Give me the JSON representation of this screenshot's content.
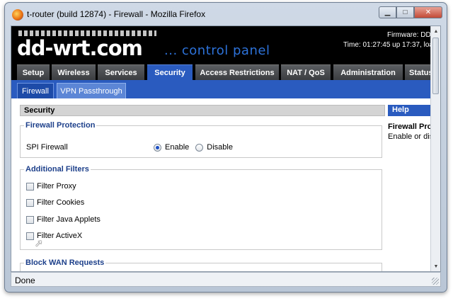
{
  "window": {
    "title": "t-router (build 12874) - Firewall - Mozilla Firefox",
    "minimize_glyph": "▁",
    "maximize_glyph": "□",
    "close_glyph": "✕"
  },
  "header": {
    "logo": "dd-wrt.com",
    "subtitle": "... control panel",
    "firmware": "Firmware: DD-",
    "time": "Time: 01:27:45 up 17:37, loa"
  },
  "main_tabs": [
    {
      "label": "Setup"
    },
    {
      "label": "Wireless"
    },
    {
      "label": "Services"
    },
    {
      "label": "Security"
    },
    {
      "label": "Access Restrictions"
    },
    {
      "label": "NAT / QoS"
    },
    {
      "label": "Administration"
    },
    {
      "label": "Status"
    }
  ],
  "sub_tabs": [
    {
      "label": "Firewall"
    },
    {
      "label": "VPN Passthrough"
    }
  ],
  "section_title": "Security",
  "help": {
    "title": "Help",
    "heading": "Firewall Pro",
    "description": "Enable or dis"
  },
  "firewall_protection": {
    "legend": "Firewall Protection",
    "label": "SPI Firewall",
    "enable_label": "Enable",
    "disable_label": "Disable",
    "selected": "Enable"
  },
  "additional_filters": {
    "legend": "Additional Filters",
    "items": [
      {
        "label": "Filter Proxy",
        "checked": false
      },
      {
        "label": "Filter Cookies",
        "checked": false
      },
      {
        "label": "Filter Java Applets",
        "checked": false
      },
      {
        "label": "Filter ActiveX",
        "checked": false
      }
    ]
  },
  "block_wan": {
    "legend": "Block WAN Requests"
  },
  "status_bar": {
    "text": "Done"
  },
  "colors": {
    "tab_active": "#2a5bbf",
    "legend_text": "#1c3f8a"
  }
}
